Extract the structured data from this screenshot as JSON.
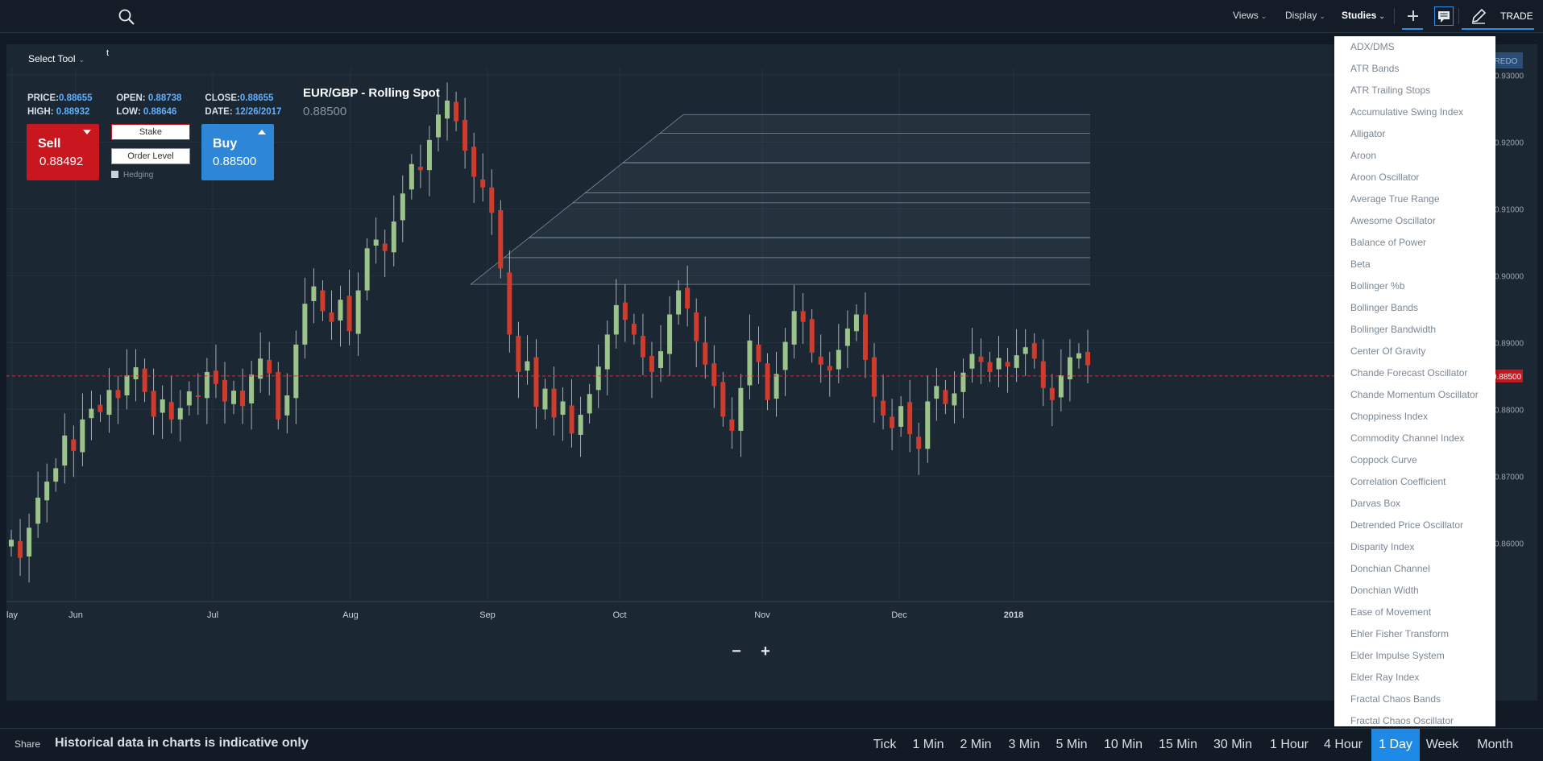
{
  "toolbar": {
    "views_label": "Views",
    "display_label": "Display",
    "studies_label": "Studies",
    "trade_label": "TRADE",
    "icons": [
      "search-icon",
      "plus-icon",
      "comment-icon",
      "pencil-icon"
    ]
  },
  "chart_header": {
    "select_tool_label": "Select Tool",
    "tool_text": "t",
    "price_label": "PRICE:",
    "price_value": "0.88655",
    "open_label": "OPEN:",
    "open_value": "0.88738",
    "close_label": "CLOSE:",
    "close_value": "0.88655",
    "high_label": "HIGH:",
    "high_value": "0.88932",
    "low_label": "LOW:",
    "low_value": "0.88646",
    "date_label": "DATE:",
    "date_value": "12/26/2017",
    "instrument": "EUR/GBP - Rolling Spot",
    "instrument_price": "0.88500"
  },
  "trade_panel": {
    "sell_label": "Sell",
    "sell_price": "0.88492",
    "buy_label": "Buy",
    "buy_price": "0.88500",
    "stake_placeholder": "Stake",
    "order_level_placeholder": "Order Level",
    "hedging_label": "Hedging"
  },
  "redo_label": "REDO",
  "chart_data": {
    "type": "candlestick",
    "instrument": "EUR/GBP - Rolling Spot",
    "x_ticks": [
      "lay",
      "Jun",
      "Jul",
      "Aug",
      "Sep",
      "Oct",
      "Nov",
      "Dec",
      "2018"
    ],
    "y_ticks": [
      "0.93000",
      "0.92000",
      "0.91000",
      "0.90000",
      "0.89000",
      "0.88000",
      "0.87000",
      "0.86000"
    ],
    "ylim": [
      0.8515,
      0.931
    ],
    "current_price": 0.885,
    "current_price_label": "0.88500",
    "colors": {
      "up": "#9cc48a",
      "down": "#cf3b2c",
      "price_line": "#d8322e",
      "grid": "#243240",
      "fib": "#9fb3c8"
    },
    "fib_levels": [
      0.9241,
      0.9213,
      0.9169,
      0.9124,
      0.9109,
      0.9057,
      0.9027,
      0.8987
    ],
    "closes": [
      0.8605,
      0.8578,
      0.8623,
      0.8668,
      0.8692,
      0.8712,
      0.8761,
      0.8738,
      0.8785,
      0.8801,
      0.8796,
      0.8829,
      0.8817,
      0.8851,
      0.8863,
      0.8826,
      0.8789,
      0.8815,
      0.8785,
      0.8802,
      0.8827,
      0.8819,
      0.8856,
      0.8838,
      0.8812,
      0.8828,
      0.8805,
      0.8852,
      0.8876,
      0.8854,
      0.8785,
      0.8821,
      0.8897,
      0.8958,
      0.8984,
      0.8947,
      0.8931,
      0.8964,
      0.8917,
      0.8978,
      0.9041,
      0.9054,
      0.9037,
      0.9081,
      0.9123,
      0.9167,
      0.9158,
      0.9203,
      0.9241,
      0.9262,
      0.9231,
      0.9187,
      0.9148,
      0.9132,
      0.9094,
      0.9011,
      0.8912,
      0.8856,
      0.8872,
      0.8804,
      0.8831,
      0.8788,
      0.8812,
      0.8764,
      0.8792,
      0.8823,
      0.8864,
      0.8912,
      0.8956,
      0.8934,
      0.8912,
      0.8878,
      0.8856,
      0.8887,
      0.8942,
      0.8978,
      0.8951,
      0.8902,
      0.8867,
      0.8835,
      0.8789,
      0.8768,
      0.8832,
      0.8903,
      0.8871,
      0.8814,
      0.8853,
      0.8901,
      0.8947,
      0.8931,
      0.8885,
      0.8867,
      0.8858,
      0.8889,
      0.8921,
      0.8942,
      0.8874,
      0.8819,
      0.8791,
      0.8772,
      0.8805,
      0.8763,
      0.8741,
      0.8812,
      0.8835,
      0.8808,
      0.8824,
      0.8855,
      0.8883,
      0.8871,
      0.8856,
      0.8877,
      0.8864,
      0.8881,
      0.8893,
      0.8876,
      0.8832,
      0.8814,
      0.8851,
      0.8878,
      0.8884,
      0.8866
    ]
  },
  "zoom": {
    "out_label": "−",
    "in_label": "+"
  },
  "studies": [
    "ADX/DMS",
    "ATR Bands",
    "ATR Trailing Stops",
    "Accumulative Swing Index",
    "Alligator",
    "Aroon",
    "Aroon Oscillator",
    "Average True Range",
    "Awesome Oscillator",
    "Balance of Power",
    "Beta",
    "Bollinger %b",
    "Bollinger Bands",
    "Bollinger Bandwidth",
    "Center Of Gravity",
    "Chande Forecast Oscillator",
    "Chande Momentum Oscillator",
    "Choppiness Index",
    "Commodity Channel Index",
    "Coppock Curve",
    "Correlation Coefficient",
    "Darvas Box",
    "Detrended Price Oscillator",
    "Disparity Index",
    "Donchian Channel",
    "Donchian Width",
    "Ease of Movement",
    "Ehler Fisher Transform",
    "Elder Impulse System",
    "Elder Ray Index",
    "Fractal Chaos Bands",
    "Fractal Chaos Oscillator"
  ],
  "footer": {
    "share_label": "Share",
    "disclaimer": "Historical data in charts is indicative only",
    "timeframes": [
      "Tick",
      "1 Min",
      "2 Min",
      "3 Min",
      "5 Min",
      "10 Min",
      "15 Min",
      "30 Min",
      "1 Hour",
      "4 Hour",
      "1 Day",
      "Week",
      "Month"
    ],
    "active_timeframe": "1 Day"
  }
}
